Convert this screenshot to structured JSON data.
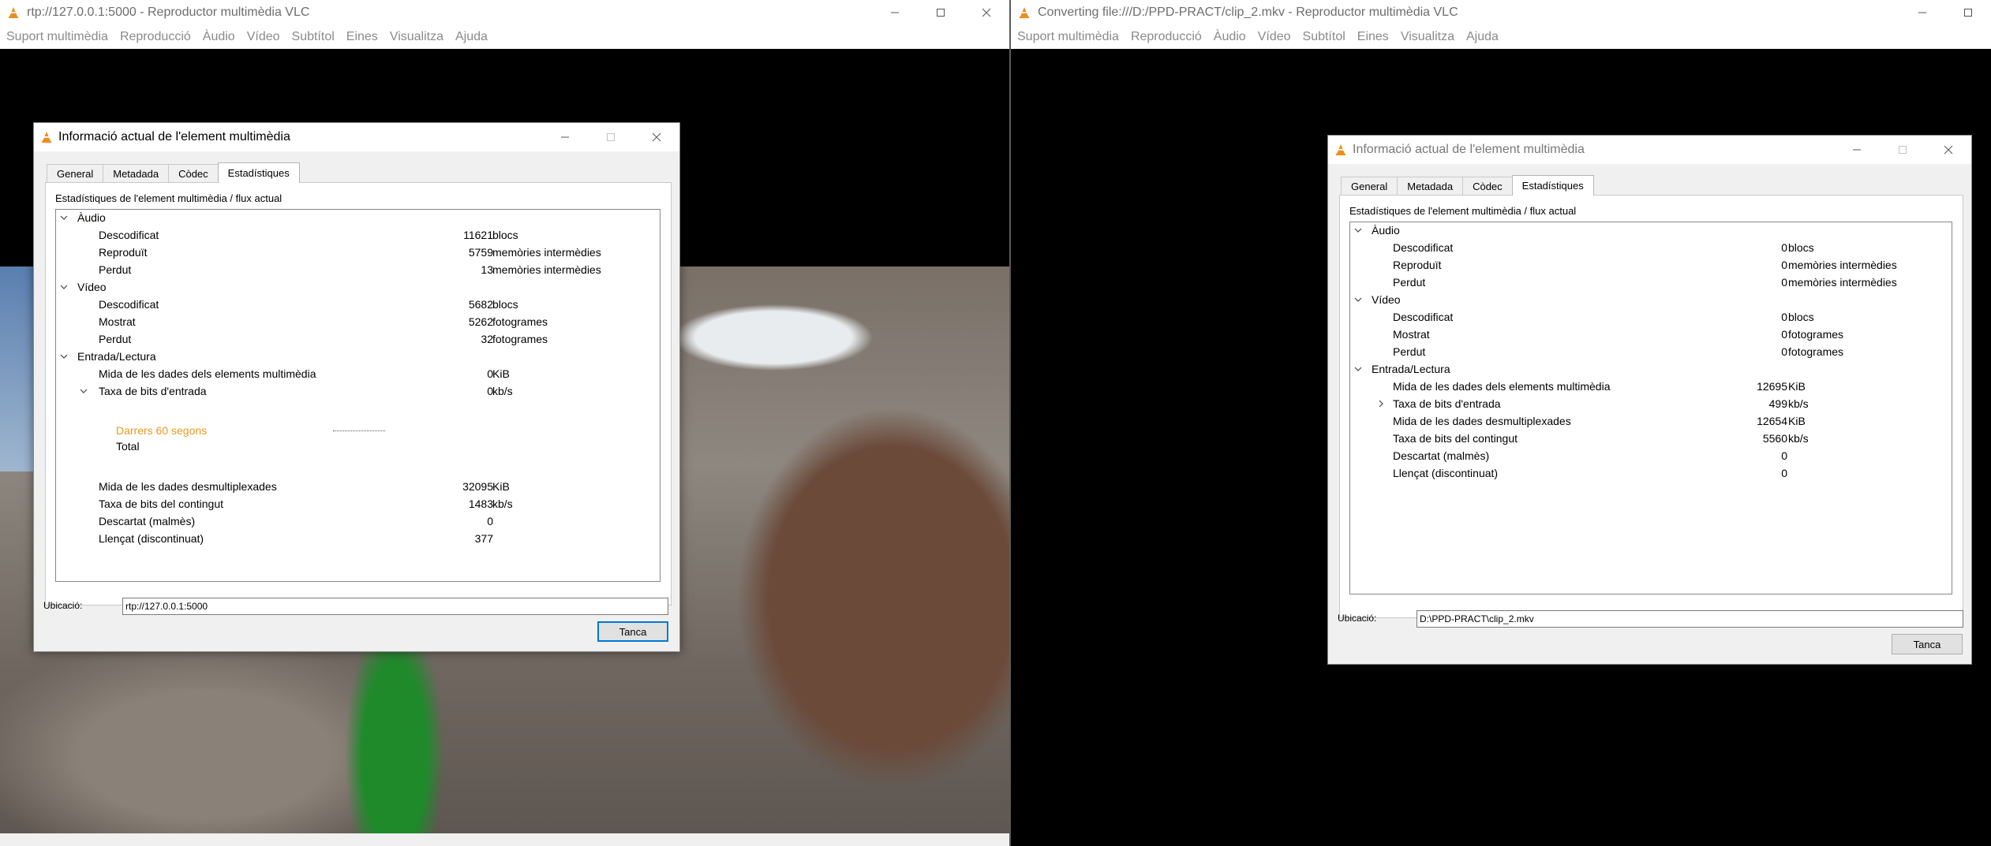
{
  "left_window": {
    "title": "rtp://127.0.0.1:5000 - Reproductor multimèdia VLC",
    "menu": [
      "Suport multimèdia",
      "Reproducció",
      "Àudio",
      "Vídeo",
      "Subtítol",
      "Eines",
      "Visualitza",
      "Ajuda"
    ],
    "dialog": {
      "title": "Informació actual de l'element multimèdia",
      "tabs": [
        "General",
        "Metadada",
        "Còdec",
        "Estadístiques"
      ],
      "active_tab": "Estadístiques",
      "heading": "Estadístiques de l'element multimèdia / flux actual",
      "audio": {
        "label": "Àudio",
        "decoded": {
          "label": "Descodificat",
          "value": "11621",
          "unit": "blocs"
        },
        "played": {
          "label": "Reproduït",
          "value": "5759",
          "unit": "memòries intermèdies"
        },
        "lost": {
          "label": "Perdut",
          "value": "13",
          "unit": "memòries intermèdies"
        }
      },
      "video": {
        "label": "Vídeo",
        "decoded": {
          "label": "Descodificat",
          "value": "5682",
          "unit": "blocs"
        },
        "displayed": {
          "label": "Mostrat",
          "value": "5262",
          "unit": "fotogrames"
        },
        "lost": {
          "label": "Perdut",
          "value": "32",
          "unit": "fotogrames"
        }
      },
      "io": {
        "label": "Entrada/Lectura",
        "media_data_size": {
          "label": "Mida de les dades dels elements multimèdia",
          "value": "0",
          "unit": "KiB"
        },
        "input_bitrate": {
          "label": "Taxa de bits d'entrada",
          "value": "0",
          "unit": "kb/s"
        },
        "last_60": {
          "label": "Darrers 60 segons"
        },
        "total": {
          "label": "Total"
        },
        "demuxed_size": {
          "label": "Mida de les dades desmultiplexades",
          "value": "32095",
          "unit": "KiB"
        },
        "content_bitrate": {
          "label": "Taxa de bits del contingut",
          "value": "1483",
          "unit": "kb/s"
        },
        "discarded": {
          "label": "Descartat (malmès)",
          "value": "0"
        },
        "dropped": {
          "label": "Llençat (discontinuat)",
          "value": "377"
        }
      },
      "location_label": "Ubicació:",
      "location_value": "rtp://127.0.0.1:5000",
      "close_label": "Tanca"
    }
  },
  "right_window": {
    "title": "Converting file:///D:/PPD-PRACT/clip_2.mkv - Reproductor multimèdia VLC",
    "menu": [
      "Suport multimèdia",
      "Reproducció",
      "Àudio",
      "Vídeo",
      "Subtítol",
      "Eines",
      "Visualitza",
      "Ajuda"
    ],
    "dialog": {
      "title": "Informació actual de l'element multimèdia",
      "tabs": [
        "General",
        "Metadada",
        "Còdec",
        "Estadístiques"
      ],
      "active_tab": "Estadístiques",
      "heading": "Estadístiques de l'element multimèdia / flux actual",
      "audio": {
        "label": "Àudio",
        "decoded": {
          "label": "Descodificat",
          "value": "0",
          "unit": "blocs"
        },
        "played": {
          "label": "Reproduït",
          "value": "0",
          "unit": "memòries intermèdies"
        },
        "lost": {
          "label": "Perdut",
          "value": "0",
          "unit": "memòries intermèdies"
        }
      },
      "video": {
        "label": "Vídeo",
        "decoded": {
          "label": "Descodificat",
          "value": "0",
          "unit": "blocs"
        },
        "displayed": {
          "label": "Mostrat",
          "value": "0",
          "unit": "fotogrames"
        },
        "lost": {
          "label": "Perdut",
          "value": "0",
          "unit": "fotogrames"
        }
      },
      "io": {
        "label": "Entrada/Lectura",
        "media_data_size": {
          "label": "Mida de les dades dels elements multimèdia",
          "value": "12695",
          "unit": "KiB"
        },
        "input_bitrate": {
          "label": "Taxa de bits d'entrada",
          "value": "499",
          "unit": "kb/s"
        },
        "demuxed_size": {
          "label": "Mida de les dades desmultiplexades",
          "value": "12654",
          "unit": "KiB"
        },
        "content_bitrate": {
          "label": "Taxa de bits del contingut",
          "value": "5560",
          "unit": "kb/s"
        },
        "discarded": {
          "label": "Descartat (malmès)",
          "value": "0"
        },
        "dropped": {
          "label": "Llençat (discontinuat)",
          "value": "0"
        }
      },
      "location_label": "Ubicació:",
      "location_value": "D:\\PPD-PRACT\\clip_2.mkv",
      "close_label": "Tanca"
    }
  },
  "icons": {
    "app": "vlc-cone-icon",
    "minimize": "minimize-icon",
    "maximize": "maximize-icon",
    "close": "close-icon",
    "expanded": "chevron-down-icon",
    "collapsed": "chevron-right-icon"
  },
  "colors": {
    "vlc_orange": "#f28c1d",
    "chart_label": "#e89a1f",
    "focus_border": "#0078d7"
  }
}
